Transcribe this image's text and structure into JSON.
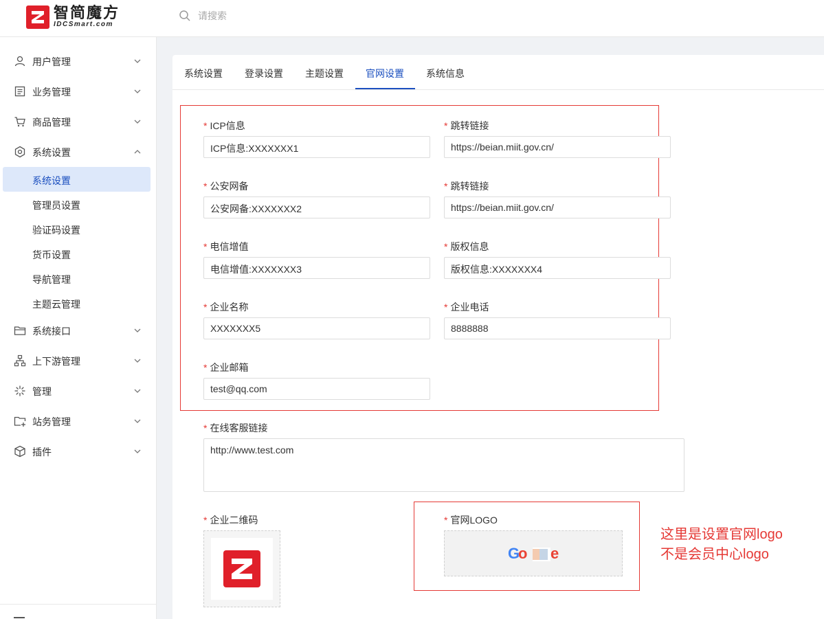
{
  "header": {
    "logo_title": "智简魔方",
    "logo_sub": "IDCSmart.com",
    "search_placeholder": "请搜索"
  },
  "sidebar": {
    "items": [
      {
        "label": "用户管理",
        "icon": "user-icon",
        "expanded": false
      },
      {
        "label": "业务管理",
        "icon": "document-icon",
        "expanded": false
      },
      {
        "label": "商品管理",
        "icon": "cart-icon",
        "expanded": false
      },
      {
        "label": "系统设置",
        "icon": "settings-icon",
        "expanded": true
      },
      {
        "label": "系统接口",
        "icon": "folder-icon",
        "expanded": false
      },
      {
        "label": "上下游管理",
        "icon": "hierarchy-icon",
        "expanded": false
      },
      {
        "label": "管理",
        "icon": "sparkle-icon",
        "expanded": false
      },
      {
        "label": "站务管理",
        "icon": "folder-plus-icon",
        "expanded": false
      },
      {
        "label": "插件",
        "icon": "cube-icon",
        "expanded": false
      }
    ],
    "sub_items": [
      {
        "label": "系统设置",
        "active": true
      },
      {
        "label": "管理员设置",
        "active": false
      },
      {
        "label": "验证码设置",
        "active": false
      },
      {
        "label": "货币设置",
        "active": false
      },
      {
        "label": "导航管理",
        "active": false
      },
      {
        "label": "主题云管理",
        "active": false
      }
    ]
  },
  "tabs": [
    {
      "label": "系统设置",
      "active": false
    },
    {
      "label": "登录设置",
      "active": false
    },
    {
      "label": "主题设置",
      "active": false
    },
    {
      "label": "官网设置",
      "active": true
    },
    {
      "label": "系统信息",
      "active": false
    }
  ],
  "form": {
    "required_mark": "*",
    "icp_label": "ICP信息",
    "icp_value": "ICP信息:XXXXXXX1",
    "icp_link_label": "跳转链接",
    "icp_link_value": "https://beian.miit.gov.cn/",
    "police_label": "公安网备",
    "police_value": "公安网备:XXXXXXX2",
    "police_link_label": "跳转链接",
    "police_link_value": "https://beian.miit.gov.cn/",
    "telecom_label": "电信增值",
    "telecom_value": "电信增值:XXXXXXX3",
    "copyright_label": "版权信息",
    "copyright_value": "版权信息:XXXXXXX4",
    "company_label": "企业名称",
    "company_value": "XXXXXXX5",
    "phone_label": "企业电话",
    "phone_value": "8888888",
    "email_label": "企业邮箱",
    "email_value": "test@qq.com",
    "service_label": "在线客服链接",
    "service_value": "http://www.test.com",
    "qrcode_label": "企业二维码",
    "logo_label": "官网LOGO"
  },
  "annotation": {
    "line1": "这里是设置官网logo",
    "line2": "不是会员中心logo",
    "color": "#e53935"
  },
  "colors": {
    "accent": "#1b4fbf",
    "brand_red": "#e0202a",
    "active_bg": "#dde8fa",
    "required": "#e53935"
  }
}
